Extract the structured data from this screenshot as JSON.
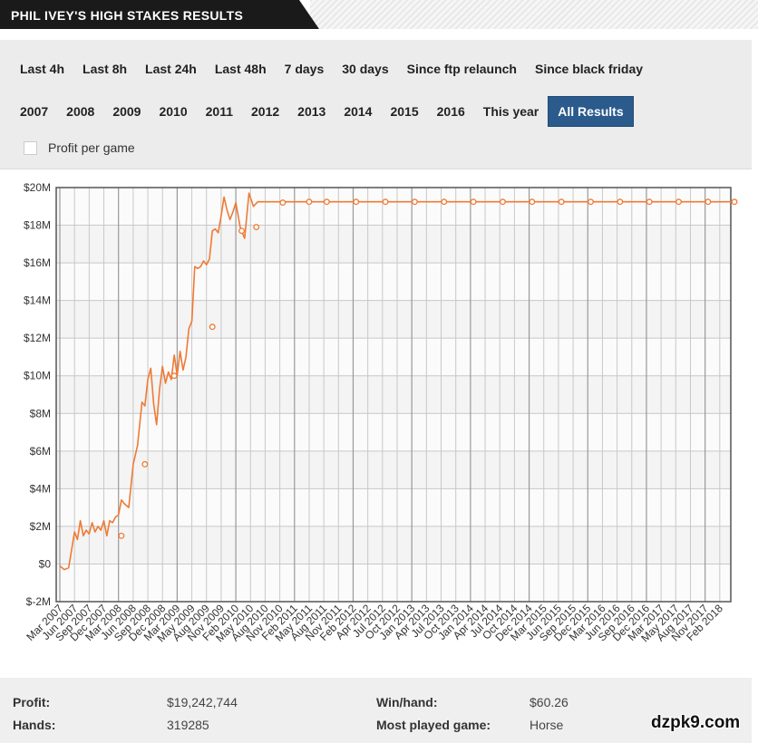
{
  "header": {
    "title": "PHIL IVEY'S HIGH STAKES RESULTS"
  },
  "filters": {
    "row1": [
      "Last 4h",
      "Last 8h",
      "Last 24h",
      "Last 48h",
      "7 days",
      "30 days",
      "Since ftp relaunch",
      "Since black friday"
    ],
    "row2": [
      "2007",
      "2008",
      "2009",
      "2010",
      "2011",
      "2012",
      "2013",
      "2014",
      "2015",
      "2016",
      "This year",
      "All Results"
    ],
    "active": "All Results",
    "profit_per_game_label": "Profit per game"
  },
  "colors": {
    "series": "#f07a35",
    "active_button": "#2b5b8c",
    "title_bg": "#1a1a1a"
  },
  "chart_data": {
    "type": "line",
    "title": "",
    "xlabel": "",
    "ylabel": "",
    "ylim": [
      -2000000,
      20000000
    ],
    "yticks": [
      -2000000,
      0,
      2000000,
      4000000,
      6000000,
      8000000,
      10000000,
      12000000,
      14000000,
      16000000,
      18000000,
      20000000
    ],
    "ytick_labels": [
      "$-2M",
      "$0",
      "$2M",
      "$4M",
      "$6M",
      "$8M",
      "$10M",
      "$12M",
      "$14M",
      "$16M",
      "$18M",
      "$20M"
    ],
    "x_tick_labels": [
      "Mar 2007",
      "Jun 2007",
      "Sep 2007",
      "Dec 2007",
      "Mar 2008",
      "Jun 2008",
      "Sep 2008",
      "Dec 2008",
      "Mar 2009",
      "May 2009",
      "Aug 2009",
      "Nov 2009",
      "Feb 2010",
      "May 2010",
      "Aug 2010",
      "Nov 2010",
      "Feb 2011",
      "May 2011",
      "Aug 2011",
      "Nov 2011",
      "Feb 2012",
      "Apr 2012",
      "Jul 2012",
      "Oct 2012",
      "Jan 2013",
      "Apr 2013",
      "Jul 2013",
      "Oct 2013",
      "Jan 2014",
      "Apr 2014",
      "Jul 2014",
      "Oct 2014",
      "Dec 2014",
      "Mar 2015",
      "Jun 2015",
      "Sep 2015",
      "Dec 2015",
      "Mar 2016",
      "Jun 2016",
      "Sep 2016",
      "Dec 2016",
      "Mar 2017",
      "May 2017",
      "Aug 2017",
      "Nov 2017",
      "Feb 2018"
    ],
    "grid": true,
    "legend": "none",
    "series": [
      {
        "x_index": [
          0,
          0.3,
          0.6,
          1.0,
          1.2,
          1.4,
          1.6,
          1.8,
          2.0,
          2.2,
          2.4,
          2.6,
          2.8,
          3.0,
          3.2,
          3.4,
          3.6,
          3.8,
          4.0,
          4.2,
          4.4,
          4.7,
          5.0,
          5.3,
          5.6,
          5.8,
          6.0,
          6.2,
          6.4,
          6.6,
          6.8,
          7.0,
          7.2,
          7.4,
          7.6,
          7.8,
          8.0,
          8.2,
          8.4,
          8.6,
          8.8,
          9.0,
          9.2,
          9.4,
          9.6,
          9.8,
          10.0,
          10.2,
          10.4,
          10.6,
          10.8,
          11.0,
          11.2,
          11.4,
          11.6,
          11.8,
          12.0,
          12.3,
          12.6,
          12.9,
          13.2,
          13.5,
          13.8,
          14.1,
          14.4,
          14.7,
          15.0,
          15.3,
          15.6,
          15.9,
          16.2,
          16.3,
          16.5,
          17.0,
          18.0,
          19.0,
          20.0,
          21.0,
          22.0,
          23.0,
          24.0,
          25.0,
          26.0,
          27.0,
          28.0,
          29.0,
          30.0,
          31.0,
          32.0,
          33.0,
          34.0,
          35.0,
          36.0,
          37.0,
          38.0,
          39.0,
          40.0,
          41.0,
          42.0,
          43.0,
          44.0,
          45.0,
          46.0
        ],
        "values": [
          -100000,
          -300000,
          -200000,
          1700000,
          1300000,
          2300000,
          1500000,
          1800000,
          1600000,
          2200000,
          1700000,
          2000000,
          1800000,
          2300000,
          1500000,
          2300000,
          2200000,
          2500000,
          2600000,
          3400000,
          3200000,
          3000000,
          5300000,
          6300000,
          8600000,
          8400000,
          9800000,
          10400000,
          8500000,
          7400000,
          9300000,
          10500000,
          9600000,
          10200000,
          9800000,
          11100000,
          10000000,
          11300000,
          10300000,
          11000000,
          12500000,
          12900000,
          15800000,
          15700000,
          15800000,
          16100000,
          15900000,
          16200000,
          17700000,
          17800000,
          17600000,
          18500000,
          19500000,
          18800000,
          18300000,
          18700000,
          19200000,
          17900000,
          17300000,
          19700000,
          19000000,
          19242744,
          19242744,
          19242744,
          19242744,
          19242744,
          19242744,
          19242744,
          19242744,
          19242744,
          19242744,
          19242744,
          19242744,
          19242744,
          19242744,
          19242744,
          19242744,
          19242744,
          19242744,
          19242744,
          19242744,
          19242744,
          19242744,
          19242744,
          19242744,
          19242744,
          19242744,
          19242744,
          19242744,
          19242744,
          19242744,
          19242744,
          19242744,
          19242744,
          19242744,
          19242744,
          19242744,
          19242744,
          19242744,
          19242744,
          19242744,
          19242744,
          19242744
        ],
        "markers": [
          [
            4.2,
            1500000
          ],
          [
            5.8,
            5300000
          ],
          [
            7.8,
            10000000
          ],
          [
            10.4,
            12600000
          ],
          [
            12.4,
            17700000
          ],
          [
            13.4,
            17900000
          ],
          [
            15.2,
            19200000
          ]
        ]
      }
    ]
  },
  "stats": {
    "profit_label": "Profit:",
    "profit_value": "$19,242,744",
    "hands_label": "Hands:",
    "hands_value": "319285",
    "winhand_label": "Win/hand:",
    "winhand_value": "$60.26",
    "mostplayed_label": "Most played game:",
    "mostplayed_value": "Horse"
  },
  "watermark": "dzpk9.com"
}
